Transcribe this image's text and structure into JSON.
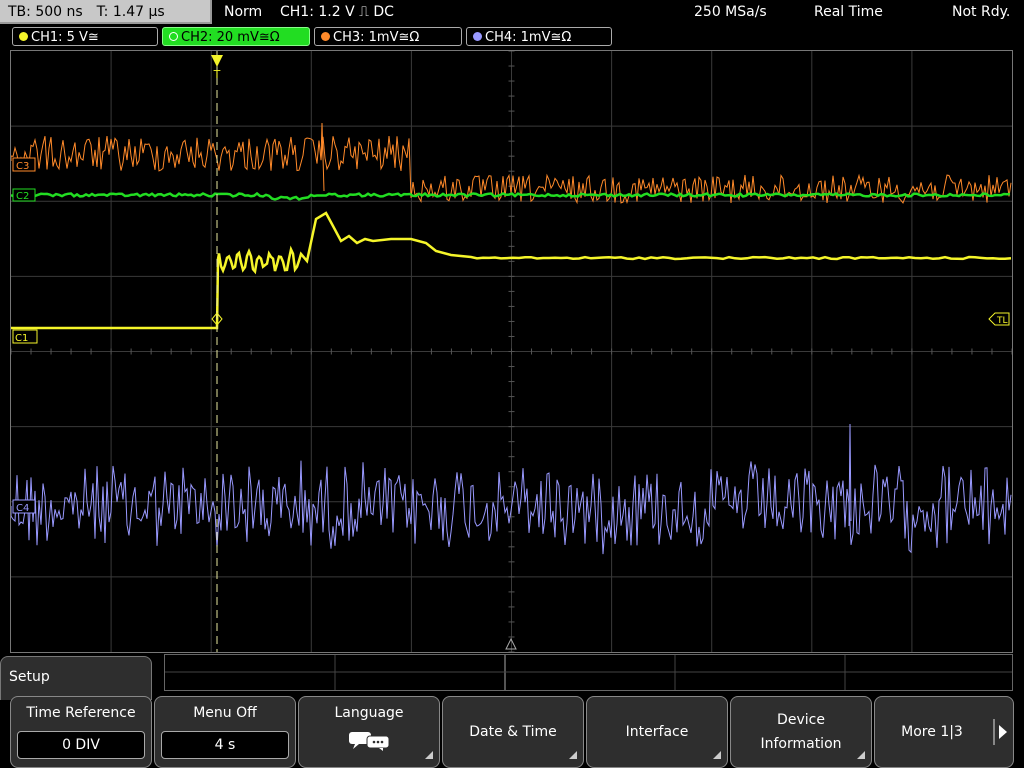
{
  "top": {
    "tb_label": "TB: 500 ns",
    "t_label": "T: 1.47 µs",
    "mode": "Norm",
    "trigger": "CH1: 1.2 V ⎍ DC",
    "sample_rate": "250 MSa/s",
    "acq_mode": "Real Time",
    "status": "Not Rdy."
  },
  "channels": [
    {
      "label": "CH1: 5 V≅",
      "color": "#f5f52a",
      "active": false
    },
    {
      "label": "CH2: 20 mV≅Ω",
      "color": "#22dd22",
      "active": true
    },
    {
      "label": "CH3: 1mV≅Ω",
      "color": "#ff8a2a",
      "active": false
    },
    {
      "label": "CH4: 1mV≅Ω",
      "color": "#9999ff",
      "active": false
    }
  ],
  "markers": {
    "ch3": "C3",
    "ch2": "C2",
    "ch1": "C1",
    "ch4": "C4",
    "trigger_level": "TL",
    "trigger_pos": "T"
  },
  "colors": {
    "ch1": "#f5f52a",
    "ch2": "#22dd22",
    "ch3": "#ff8a2a",
    "ch4": "#9999ff",
    "grid": "#3a3a3a"
  },
  "menu": {
    "title": "Setup",
    "softkeys": [
      {
        "title": "Time Reference",
        "value": "0 DIV"
      },
      {
        "title": "Menu Off",
        "value": "4 s"
      },
      {
        "title": "Language",
        "icon": "speech-bubbles-icon"
      },
      {
        "title": "Date & Time"
      },
      {
        "title": "Interface"
      },
      {
        "title1": "Device",
        "title2": "Information"
      },
      {
        "title": "More 1|3"
      }
    ]
  }
}
